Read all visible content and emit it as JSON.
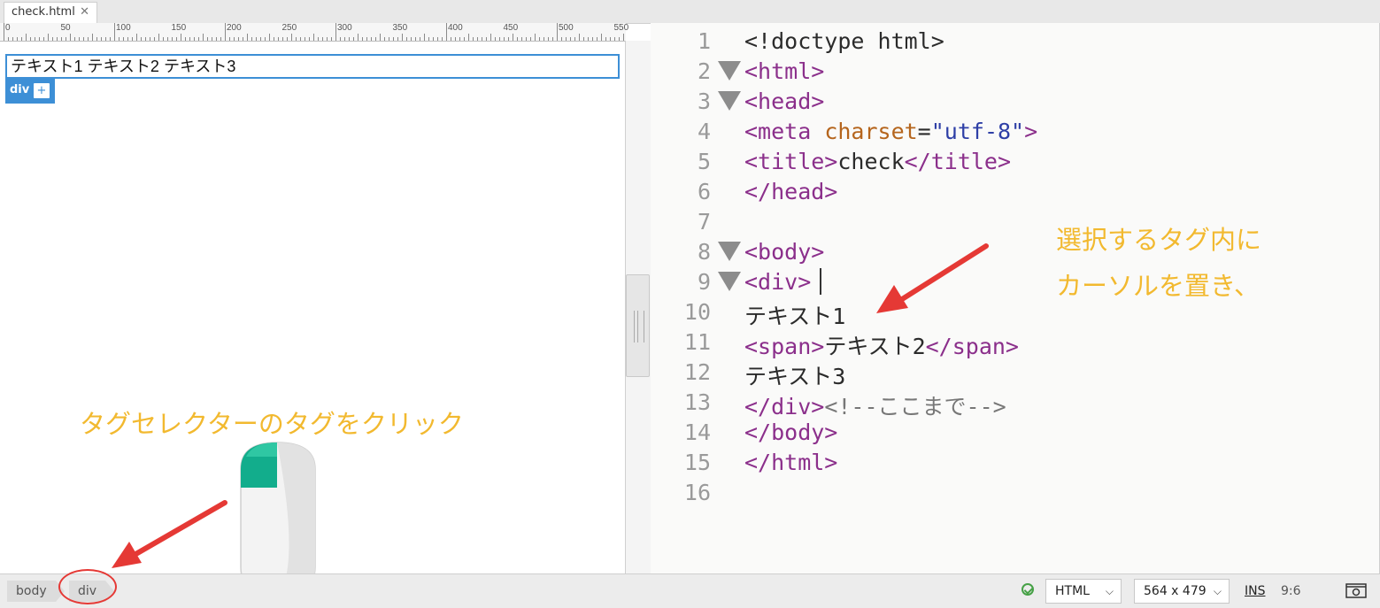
{
  "tab": {
    "label": "check.html",
    "close": "✕"
  },
  "ruler": {
    "labels": [
      "0",
      "50",
      "100",
      "150",
      "200",
      "250",
      "300",
      "350",
      "400",
      "450",
      "500",
      "550"
    ]
  },
  "design": {
    "selected_text": "テキスト1 テキスト2 テキスト3",
    "tag_label": "div",
    "plus_label": "+"
  },
  "code": {
    "line_numbers": [
      "1",
      "2",
      "3",
      "4",
      "5",
      "6",
      "7",
      "8",
      "9",
      "10",
      "11",
      "12",
      "13",
      "14",
      "15",
      "16"
    ]
  },
  "annotations": {
    "right_line1": "選択するタグ内に",
    "right_line2": "カーソルを置き、",
    "left": "タグセレクターのタグをクリック"
  },
  "status": {
    "crumb_body": "body",
    "crumb_div": "div",
    "language": "HTML",
    "viewport": "564 x 479",
    "mode": "INS",
    "position": "9:6",
    "icons": [
      "check-circle-icon",
      "chevron-down-icon",
      "preview-device-icon",
      "arrow-icon",
      "mouse-icon"
    ],
    "accent_color": "#3d8fd6",
    "annotation_color": "#f2b92f",
    "arrow_color": "#e53935"
  }
}
